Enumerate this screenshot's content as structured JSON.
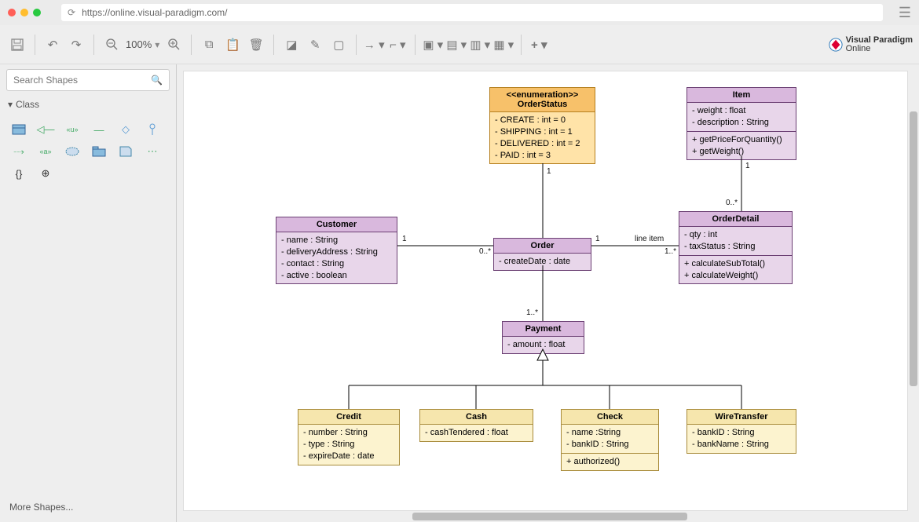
{
  "browser": {
    "url": "https://online.visual-paradigm.com/"
  },
  "toolbar": {
    "zoom": "100%"
  },
  "logo": {
    "line1": "Visual Paradigm",
    "line2": "Online"
  },
  "sidebar": {
    "search_placeholder": "Search Shapes",
    "category": "Class",
    "more": "More Shapes..."
  },
  "classes": {
    "orderStatus": {
      "stereotype": "<<enumeration>>",
      "name": "OrderStatus",
      "literals": [
        "- CREATE : int  = 0",
        "- SHIPPING : int = 1",
        "- DELIVERED : int = 2",
        "- PAID : int = 3"
      ]
    },
    "item": {
      "name": "Item",
      "attrs": [
        "- weight : float",
        "- description : String"
      ],
      "ops": [
        "+ getPriceForQuantity()",
        "+ getWeight()"
      ]
    },
    "customer": {
      "name": "Customer",
      "attrs": [
        "- name : String",
        "- deliveryAddress : String",
        "- contact : String",
        "- active : boolean"
      ]
    },
    "order": {
      "name": "Order",
      "attrs": [
        "- createDate : date"
      ]
    },
    "orderDetail": {
      "name": "OrderDetail",
      "attrs": [
        "- qty : int",
        "- taxStatus : String"
      ],
      "ops": [
        "+ calculateSubTotal()",
        "+ calculateWeight()"
      ]
    },
    "payment": {
      "name": "Payment",
      "attrs": [
        "- amount : float"
      ]
    },
    "credit": {
      "name": "Credit",
      "attrs": [
        "- number : String",
        "- type : String",
        "- expireDate : date"
      ]
    },
    "cash": {
      "name": "Cash",
      "attrs": [
        "- cashTendered : float"
      ]
    },
    "check": {
      "name": "Check",
      "attrs": [
        "- name :String",
        "- bankID : String"
      ],
      "ops": [
        "+ authorized()"
      ]
    },
    "wireTransfer": {
      "name": "WireTransfer",
      "attrs": [
        "- bankID : String",
        "- bankName : String"
      ]
    }
  },
  "labels": {
    "one_a": "1",
    "zeroStar_a": "0..*",
    "one_b": "1",
    "one_c": "1",
    "oneStar_b": "1..*",
    "lineItem": "line item",
    "zeroStar_c": "0..*",
    "one_d": "1",
    "oneStar_a": "1..*"
  }
}
